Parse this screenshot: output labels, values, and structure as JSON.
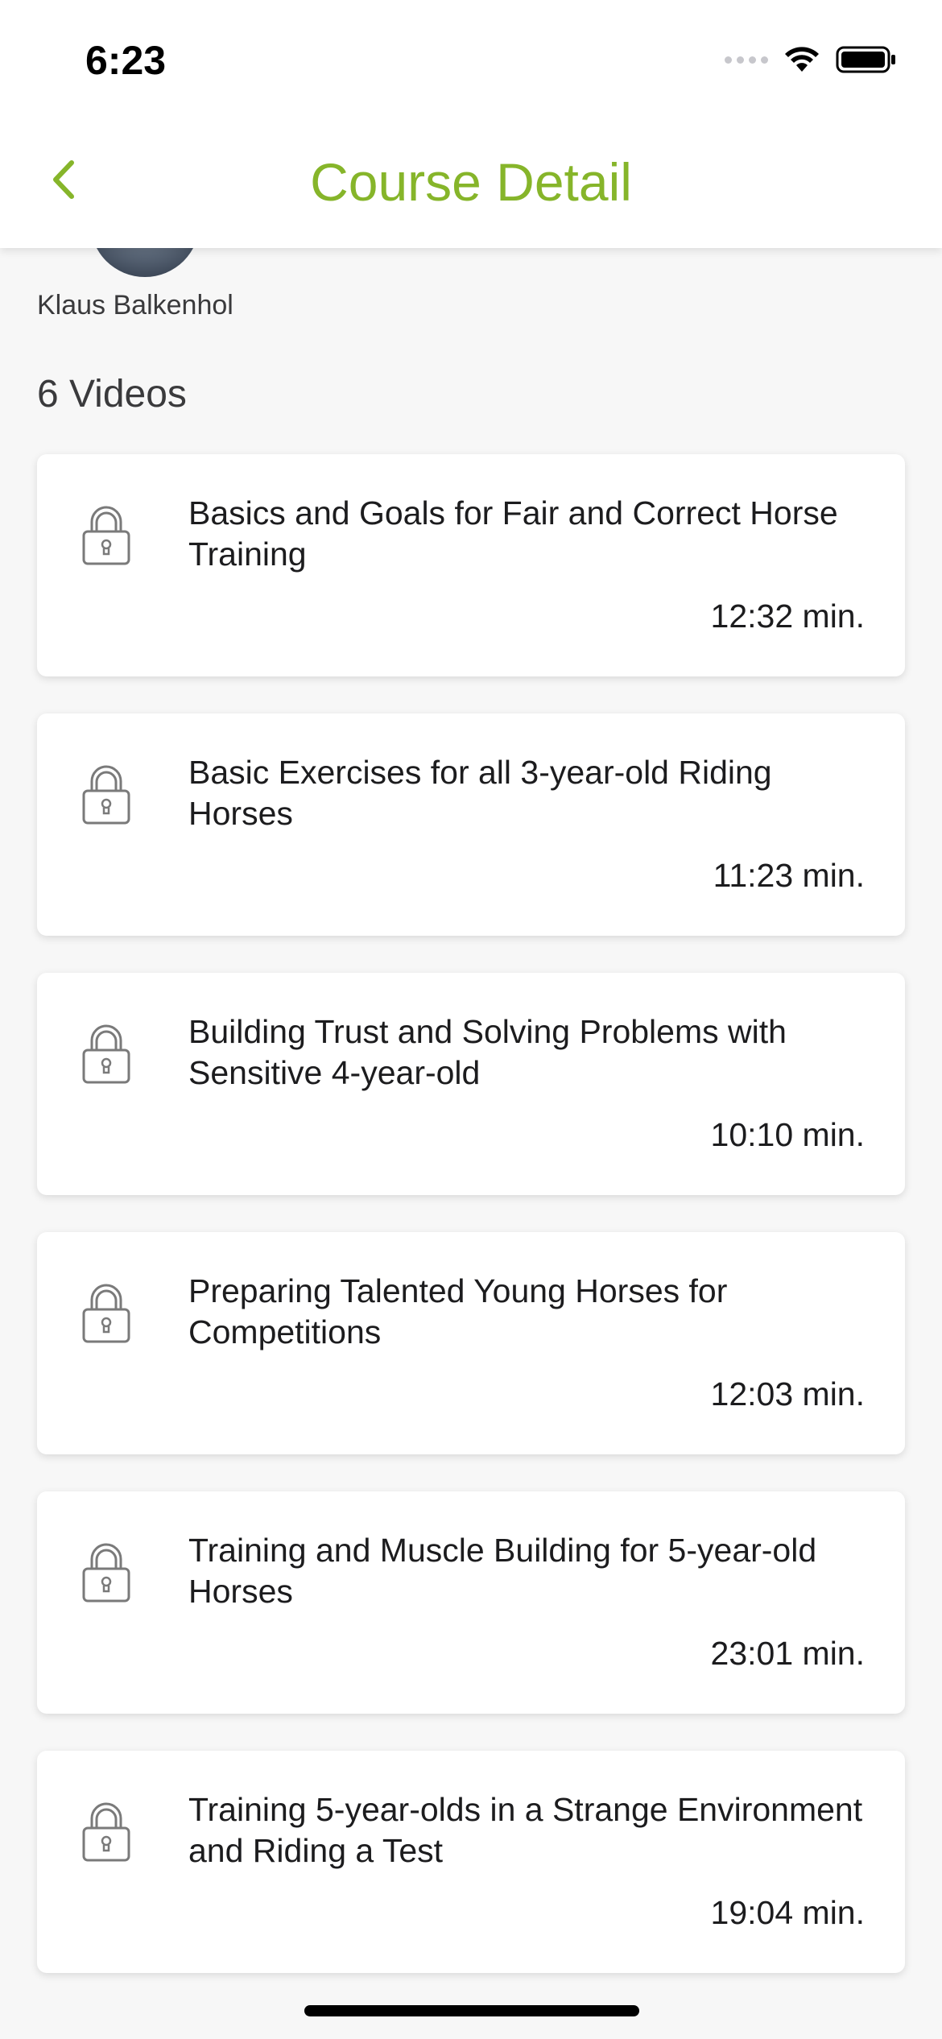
{
  "status_bar": {
    "time": "6:23"
  },
  "header": {
    "title": "Course Detail",
    "title_color": "#86b52a"
  },
  "author": {
    "name": "Klaus Balkenhol"
  },
  "videos_count_label": "6 Videos",
  "videos": [
    {
      "title": "Basics and Goals for Fair and Correct Horse Training",
      "duration": "12:32 min.",
      "icon": "lock-icon"
    },
    {
      "title": "Basic Exercises for all 3-year-old Riding Horses",
      "duration": "11:23 min.",
      "icon": "lock-icon"
    },
    {
      "title": "Building Trust and Solving Problems with Sensitive 4-year-old",
      "duration": "10:10 min.",
      "icon": "lock-icon"
    },
    {
      "title": "Preparing Talented Young Horses for Competitions",
      "duration": "12:03 min.",
      "icon": "lock-icon"
    },
    {
      "title": "Training and Muscle Building for 5-year-old Horses",
      "duration": "23:01 min.",
      "icon": "lock-icon"
    },
    {
      "title": "Training 5-year-olds in a Strange Environment and Riding a Test",
      "duration": "19:04 min.",
      "icon": "lock-icon"
    }
  ]
}
